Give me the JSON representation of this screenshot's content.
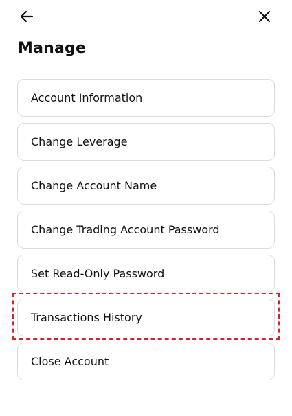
{
  "header": {
    "title": "Manage",
    "back_icon": "arrow-left-icon",
    "close_icon": "close-icon"
  },
  "menu": {
    "items": [
      {
        "label": "Account Information"
      },
      {
        "label": "Change Leverage"
      },
      {
        "label": "Change Account Name"
      },
      {
        "label": "Change Trading Account Password"
      },
      {
        "label": "Set Read-Only Password"
      },
      {
        "label": "Transactions History",
        "highlighted": true
      },
      {
        "label": "Close Account"
      }
    ]
  },
  "colors": {
    "highlight_border": "#d6232a",
    "item_border": "#dcdcdc"
  }
}
